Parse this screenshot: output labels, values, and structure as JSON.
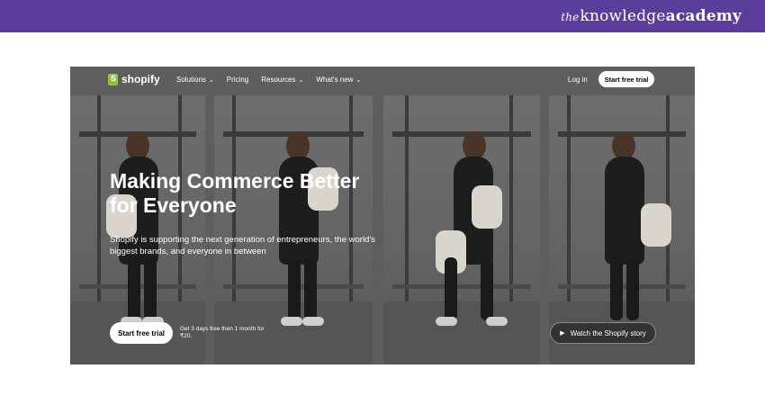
{
  "banner": {
    "brand_the": "the",
    "brand_knowledge": "knowledge",
    "brand_academy": "academy",
    "color": "#5b3e9c"
  },
  "shopify": {
    "logo_text": "shopify",
    "nav": [
      {
        "label": "Solutions",
        "dropdown": true
      },
      {
        "label": "Pricing",
        "dropdown": false
      },
      {
        "label": "Resources",
        "dropdown": true
      },
      {
        "label": "What's new",
        "dropdown": true
      }
    ],
    "login": "Log in",
    "nav_button": "Start free trial",
    "headline": "Making Commerce Better for Everyone",
    "subtext": "Shopify is supporting the next generation of entrepreneurs, the world's biggest brands, and everyone in between",
    "cta_button": "Start free trial",
    "offer_text": "Get 3 days free then 1 month for ₹20.",
    "watch_button": "Watch the Shopify story",
    "icons": {
      "logo": "shopify-bag-icon",
      "chevron": "chevron-down-icon",
      "play": "play-icon"
    },
    "accent": "#95bf47"
  }
}
